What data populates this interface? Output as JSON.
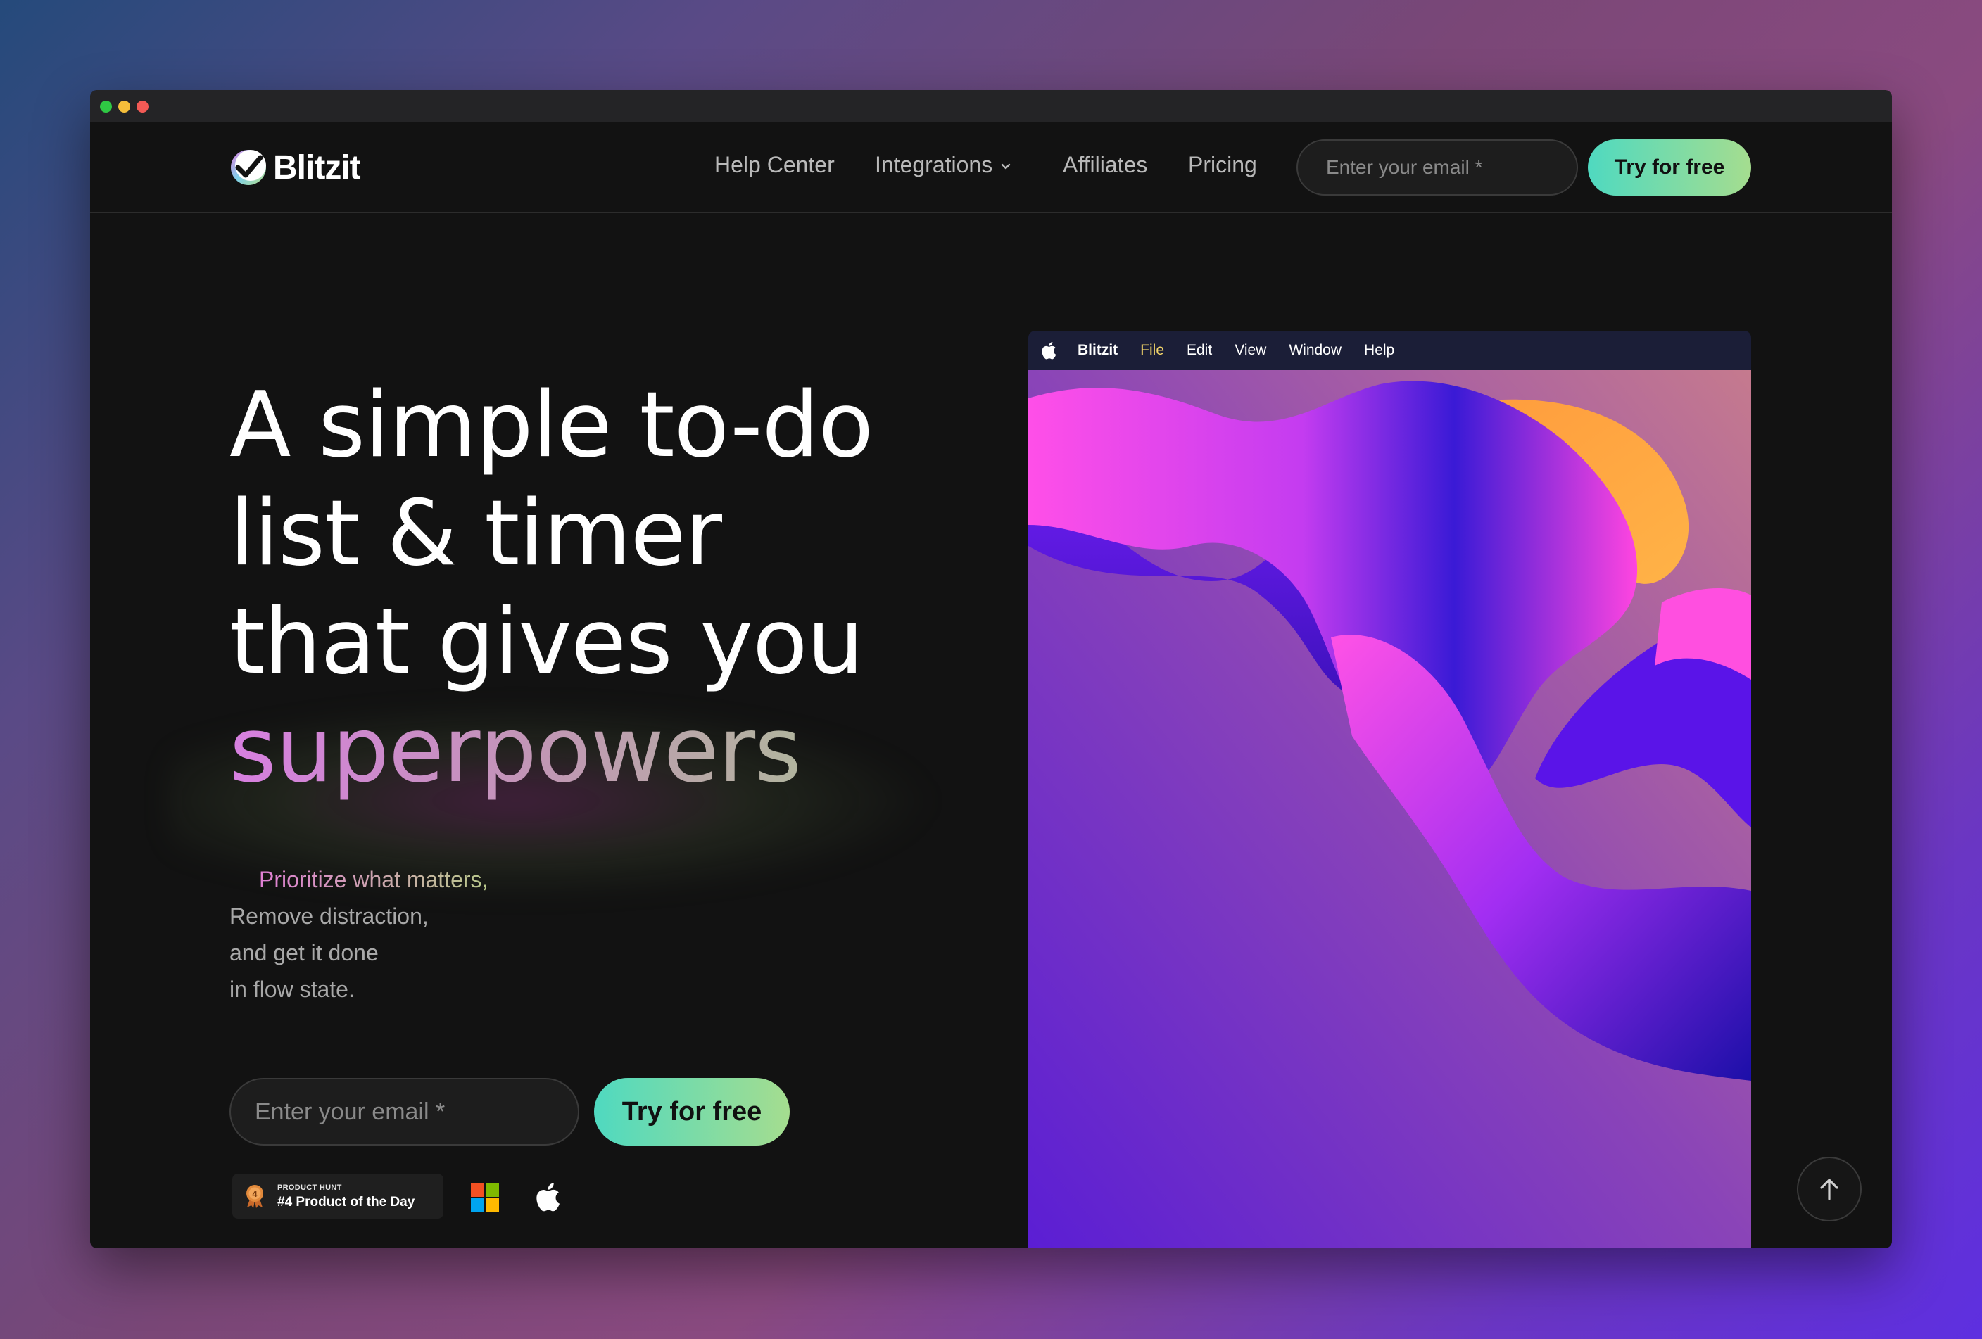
{
  "brand": {
    "name": "Blitzit"
  },
  "nav": {
    "links": [
      "Help Center",
      "Integrations",
      "Affiliates",
      "Pricing"
    ],
    "email_placeholder": "Enter your email *",
    "cta": "Try for free"
  },
  "hero": {
    "headline": [
      "A simple to-do",
      "list & timer",
      "that gives you",
      "superpowers"
    ],
    "subtext": [
      "Prioritize what matters,",
      "Remove distraction,",
      "and get it done",
      "in flow state."
    ],
    "email_placeholder": "Enter your email *",
    "cta": "Try for free"
  },
  "badges": {
    "producthunt": {
      "rank": "4",
      "label_small": "PRODUCT HUNT",
      "label": "#4 Product of the Day"
    },
    "platforms": [
      "windows-icon",
      "apple-icon"
    ]
  },
  "app_preview": {
    "menu": [
      "Blitzit",
      "File",
      "Edit",
      "View",
      "Window",
      "Help"
    ]
  },
  "colors": {
    "accent_start": "#4fd9c0",
    "accent_end": "#a5dd8f",
    "background": "#121212"
  }
}
